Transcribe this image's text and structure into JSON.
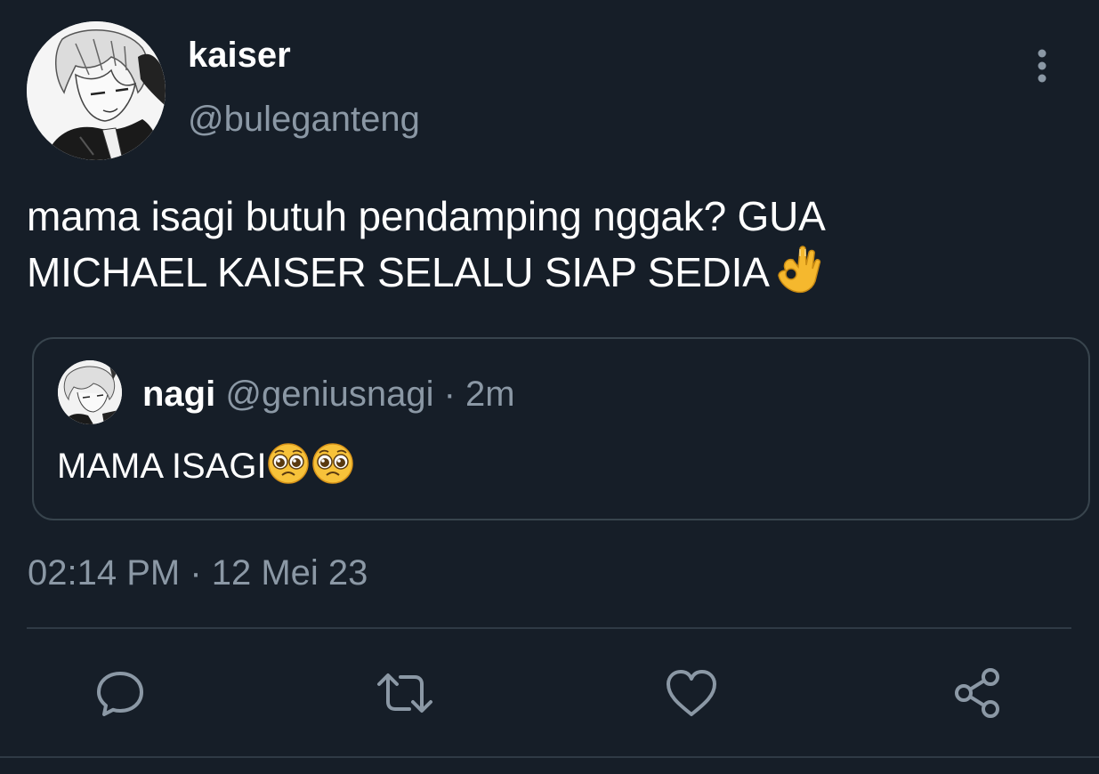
{
  "tweet": {
    "author": {
      "name": "kaiser",
      "handle": "@buleganteng",
      "avatar_icon": "manga-avatar"
    },
    "text_line1": "mama isagi butuh pendamping nggak? GUA",
    "text_line2": "MICHAEL KAISER SELALU SIAP SEDIA",
    "text_emoji": "ok-hand-emoji",
    "timestamp": "02:14 PM · 12 Mei 23",
    "more_icon": "vertical-ellipsis-icon"
  },
  "quoted_tweet": {
    "name": "nagi",
    "handle": "@geniusnagi",
    "time": " · 2m",
    "text": "MAMA ISAGI",
    "emojis": [
      "pleading-face-emoji",
      "pleading-face-emoji"
    ]
  },
  "actions": [
    {
      "name": "reply",
      "icon": "speech-bubble-icon"
    },
    {
      "name": "retweet",
      "icon": "retweet-arrows-icon"
    },
    {
      "name": "like",
      "icon": "heart-icon"
    },
    {
      "name": "share",
      "icon": "share-nodes-icon"
    }
  ],
  "colors": {
    "background": "#161e28",
    "primary_text": "#ffffff",
    "secondary_text": "#8b98a5",
    "border": "#38444d"
  }
}
